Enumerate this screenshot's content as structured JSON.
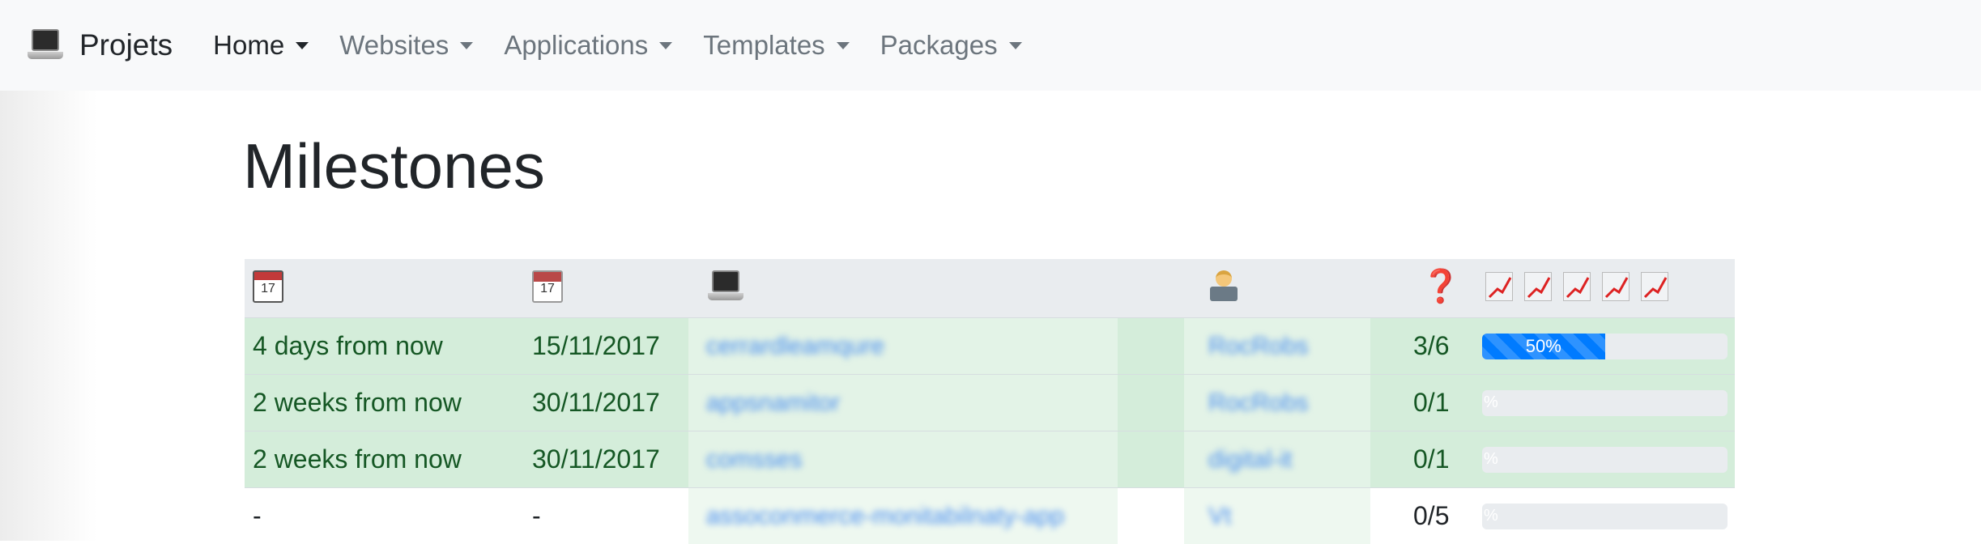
{
  "navbar": {
    "brand_icon": "laptop-icon",
    "brand": "Projets",
    "items": [
      {
        "label": "Home",
        "active": true
      },
      {
        "label": "Websites",
        "active": false
      },
      {
        "label": "Applications",
        "active": false
      },
      {
        "label": "Templates",
        "active": false
      },
      {
        "label": "Packages",
        "active": false
      }
    ]
  },
  "page": {
    "title": "Milestones"
  },
  "table": {
    "header_icons": [
      "calendar-pencil-icon",
      "calendar-icon",
      "laptop-icon",
      "developer-icon",
      "question-mark-icon",
      "chart-increasing-icon"
    ],
    "header_calendar_num": "17",
    "header_question": "❓",
    "rows": [
      {
        "due": "4 days from now",
        "date": "15/11/2017",
        "project": "cerrardleamqure",
        "user": "RocRobs",
        "count": "3/6",
        "progress": 50,
        "progress_label": "50%",
        "status": "success"
      },
      {
        "due": "2 weeks from now",
        "date": "30/11/2017",
        "project": "appsnamitor",
        "user": "RocRobs",
        "count": "0/1",
        "progress": 0,
        "progress_label": "%",
        "status": "success"
      },
      {
        "due": "2 weeks from now",
        "date": "30/11/2017",
        "project": "comsses",
        "user": "digital-it",
        "count": "0/1",
        "progress": 0,
        "progress_label": "%",
        "status": "success"
      },
      {
        "due": "-",
        "date": "-",
        "project": "assoconmerce-monitabilnaty-app",
        "user": "Vt",
        "count": "0/5",
        "progress": 0,
        "progress_label": "%",
        "status": "plain"
      }
    ]
  },
  "colors": {
    "success_bg": "#d4edda",
    "success_text": "#155724",
    "progress": "#007bff",
    "nav_bg": "#f8f9fa",
    "header_bg": "#e9ecef"
  }
}
